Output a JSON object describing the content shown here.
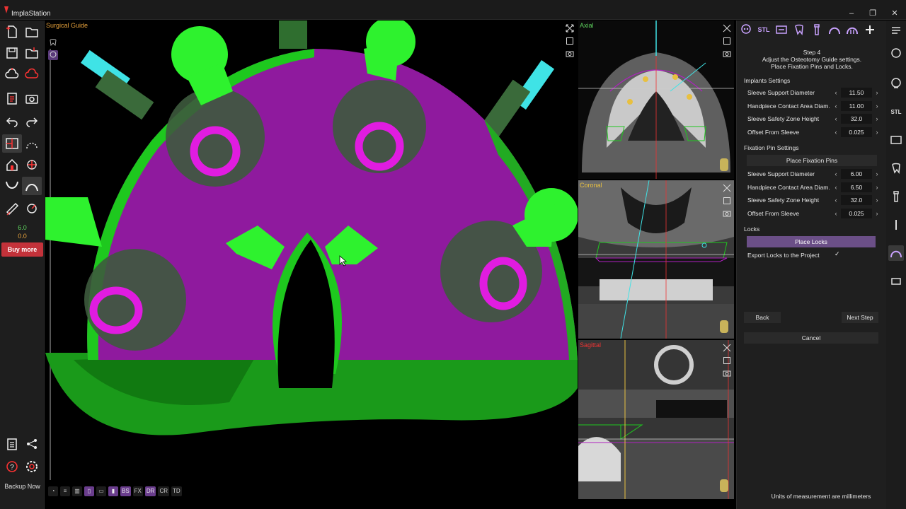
{
  "window": {
    "title": "ImplaStation"
  },
  "left_toolbar": {
    "value_green": "6.0",
    "value_orange": "0.0",
    "buy_more": "Buy more",
    "backup": "Backup Now"
  },
  "viewport3d": {
    "label": "Surgical Guide"
  },
  "bottom_strip": {
    "chips": [
      "BS",
      "FX",
      "DR",
      "CR",
      "TD"
    ]
  },
  "slices": {
    "axial": "Axial",
    "coronal": "Coronal",
    "sagittal": "Sagittal"
  },
  "right_panel": {
    "tabs": [
      "STL"
    ],
    "step": {
      "title": "Step 4",
      "line1": "Adjust the Osteotomy Guide settings.",
      "line2": "Place Fixation Pins and Locks."
    },
    "implants_section": "Implants Settings",
    "implants": [
      {
        "label": "Sleeve Support Diameter",
        "value": "11.50"
      },
      {
        "label": "Handpiece Contact Area Diam.",
        "value": "11.00"
      },
      {
        "label": "Sleeve Safety Zone Height",
        "value": "32.0"
      },
      {
        "label": "Offset From Sleeve",
        "value": "0.025"
      }
    ],
    "fixation_section": "Fixation Pin Settings",
    "place_fixation_pins": "Place Fixation Pins",
    "fixation": [
      {
        "label": "Sleeve Support Diameter",
        "value": "6.00"
      },
      {
        "label": "Handpiece Contact Area Diam.",
        "value": "6.50"
      },
      {
        "label": "Sleeve Safety Zone Height",
        "value": "32.0"
      },
      {
        "label": "Offset From Sleeve",
        "value": "0.025"
      }
    ],
    "locks_section": "Locks",
    "place_locks": "Place Locks",
    "export_locks": "Export Locks to the Project",
    "export_locks_checked": "✓",
    "back": "Back",
    "next": "Next Step",
    "cancel": "Cancel",
    "units": "Units of measurement are millimeters"
  },
  "far_right": {
    "stl": "STL"
  },
  "colors": {
    "accent": "#c9a2ff",
    "guide_purple": "#8f1a9e",
    "guide_green": "#1ec81e",
    "sleeve_magenta": "#e01ce0",
    "pin_cyan": "#3fe3e6",
    "buy_red": "#c3323a"
  }
}
